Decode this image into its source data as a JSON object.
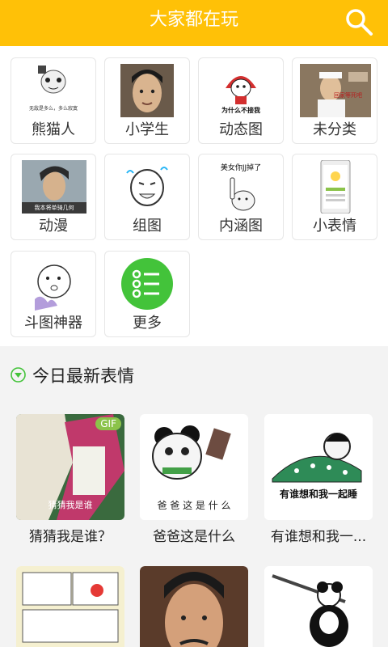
{
  "header": {
    "title": "大家都在玩"
  },
  "categories": [
    {
      "label": "熊猫人",
      "caption": "无敌是多么，多么寂寞"
    },
    {
      "label": "小学生"
    },
    {
      "label": "动态图",
      "caption": "为什么不接我"
    },
    {
      "label": "未分类",
      "caption": "回家等死吧"
    },
    {
      "label": "动漫",
      "caption": "我本将单骑几何"
    },
    {
      "label": "组图"
    },
    {
      "label": "内涵图",
      "caption": "美女你JJ掉了"
    },
    {
      "label": "小表情"
    },
    {
      "label": "斗图神器"
    },
    {
      "label": "更多"
    }
  ],
  "section": {
    "title": "今日最新表情"
  },
  "cards": [
    {
      "caption": "猜猜我是谁？",
      "badge": "GIF",
      "img_text": "猜猜我是谁"
    },
    {
      "caption": "爸爸这是什么",
      "img_text": "爸 爸 这 是 什 么"
    },
    {
      "caption": "有谁想和我一...",
      "img_text": "有谁想和我一起睡"
    },
    {
      "caption": ""
    },
    {
      "caption": ""
    },
    {
      "caption": ""
    }
  ]
}
